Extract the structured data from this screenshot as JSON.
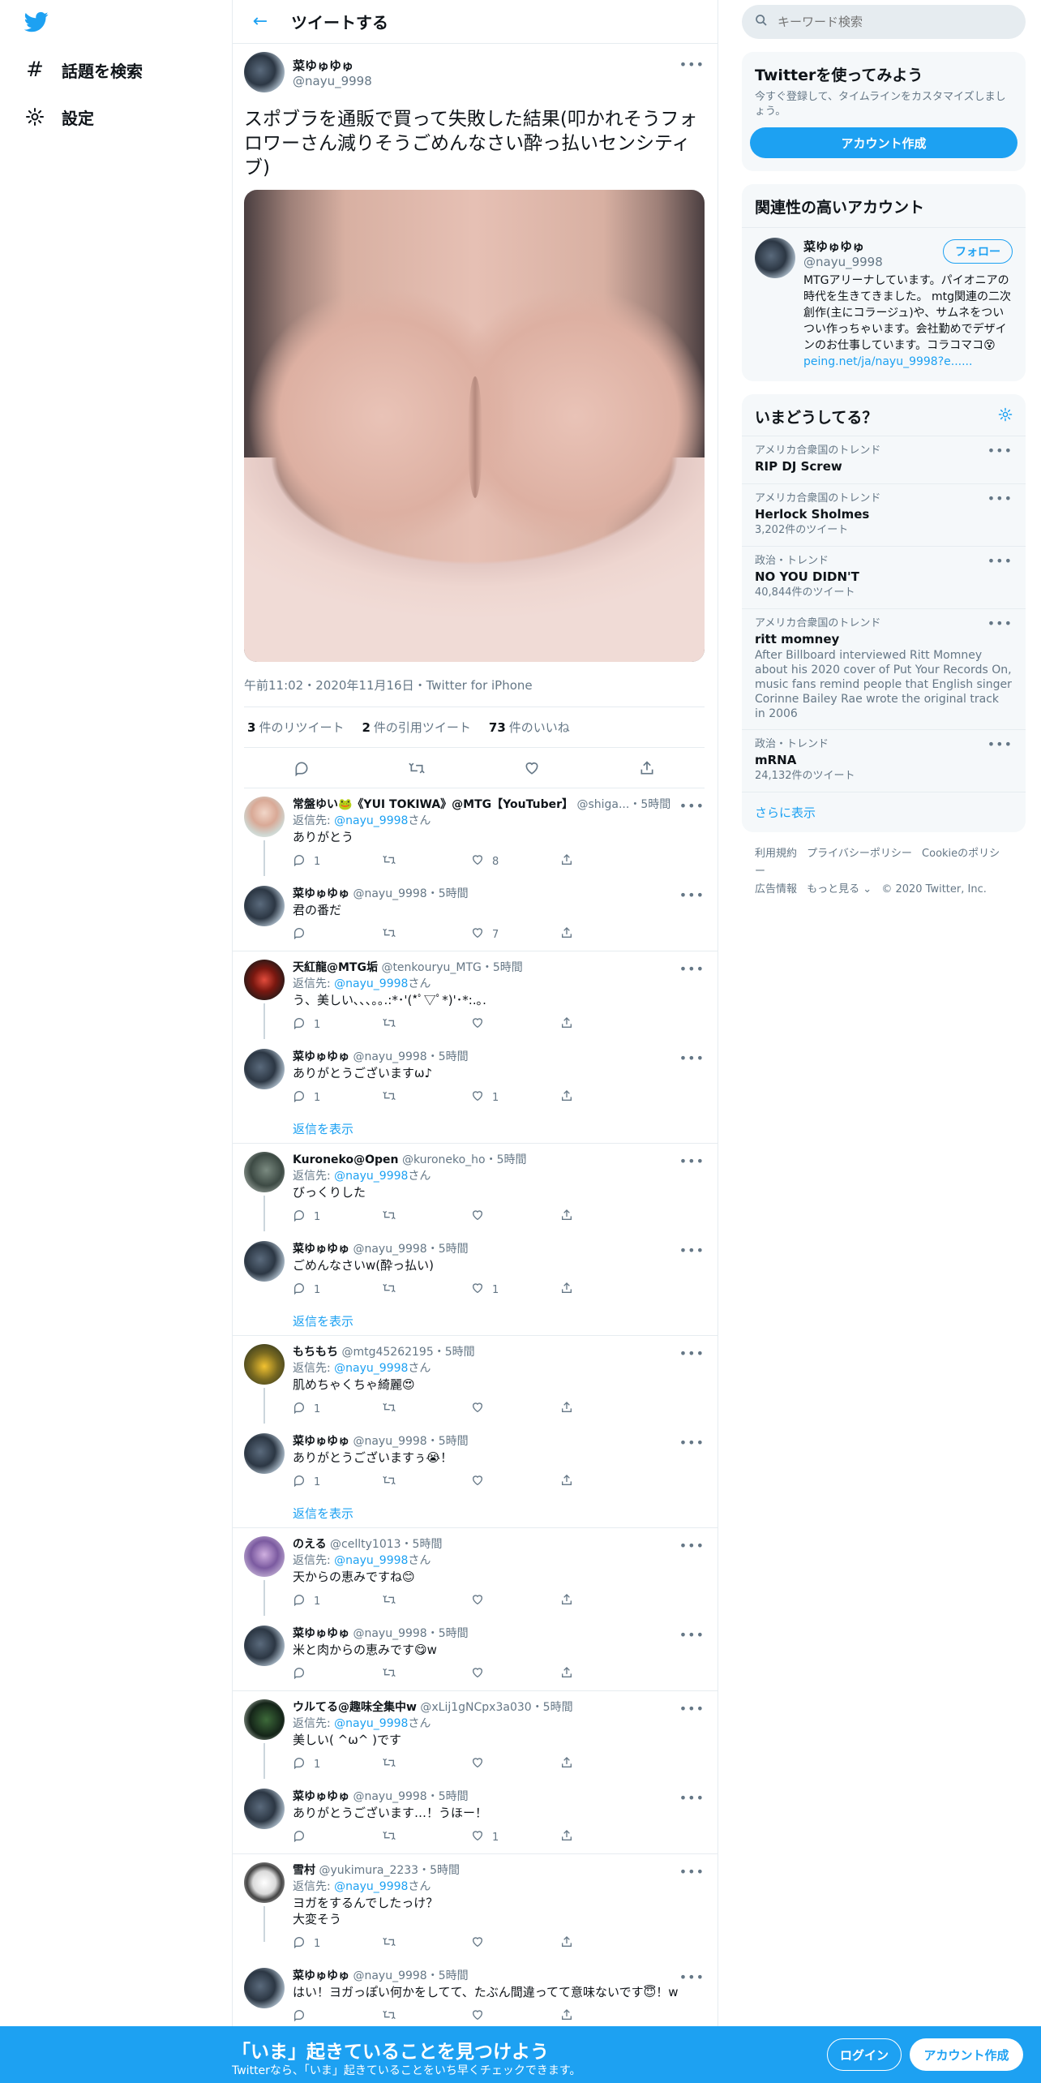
{
  "nav": {
    "explore": "話題を検索",
    "settings": "設定"
  },
  "header": {
    "title": "ツイートする"
  },
  "tweet": {
    "name": "菜ゆゅゆゅ",
    "handle": "@nayu_9998",
    "text": "スポブラを通販で買って失敗した結果(叩かれそうフォロワーさん減りそうごめんなさい酔っ払いセンシティブ)",
    "timestamp": "午前11:02・2020年11月16日・Twitter for iPhone",
    "retweets": "3",
    "retweets_label": "件のリツイート",
    "quotes": "2",
    "quotes_label": "件の引用ツイート",
    "likes": "73",
    "likes_label": "件のいいね"
  },
  "replies": [
    {
      "name": "常盤ゆい🐸《YUI TOKIWA》@MTG【YouTuber】",
      "handle": "@shiga...",
      "time": "・5時間",
      "reply_to_prefix": "返信先: ",
      "reply_to": "@nayu_9998",
      "reply_to_suffix": "さん",
      "text": "ありがとう",
      "reply_count": "1",
      "retweet_count": "",
      "like_count": "8"
    },
    {
      "name": "菜ゆゅゆゅ",
      "handle": "@nayu_9998",
      "time": "・5時間",
      "text": "君の番だ",
      "reply_count": "",
      "retweet_count": "",
      "like_count": "7"
    },
    {
      "name": "天紅龍@MTG垢",
      "handle": "@tenkouryu_MTG",
      "time": "・5時間",
      "reply_to_prefix": "返信先: ",
      "reply_to": "@nayu_9998",
      "reply_to_suffix": "さん",
      "text": "う、美しい､､､｡｡.:*･'(*ﾟ▽ﾟ*)'･*:.｡.",
      "reply_count": "1",
      "retweet_count": "",
      "like_count": ""
    },
    {
      "name": "菜ゆゅゆゅ",
      "handle": "@nayu_9998",
      "time": "・5時間",
      "text": "ありがとうございますω♪",
      "reply_count": "1",
      "retweet_count": "",
      "like_count": "1"
    },
    {
      "name": "Kuroneko@Open",
      "handle": "@kuroneko_ho",
      "time": "・5時間",
      "reply_to_prefix": "返信先: ",
      "reply_to": "@nayu_9998",
      "reply_to_suffix": "さん",
      "text": "びっくりした",
      "reply_count": "1",
      "retweet_count": "",
      "like_count": ""
    },
    {
      "name": "菜ゆゅゆゅ",
      "handle": "@nayu_9998",
      "time": "・5時間",
      "text": "ごめんなさいw(酔っ払い)",
      "reply_count": "1",
      "retweet_count": "",
      "like_count": "1"
    },
    {
      "name": "もちもち",
      "handle": "@mtg45262195",
      "time": "・5時間",
      "reply_to_prefix": "返信先: ",
      "reply_to": "@nayu_9998",
      "reply_to_suffix": "さん",
      "text": "肌めちゃくちゃ綺麗😍",
      "reply_count": "1",
      "retweet_count": "",
      "like_count": ""
    },
    {
      "name": "菜ゆゅゆゅ",
      "handle": "@nayu_9998",
      "time": "・5時間",
      "text": "ありがとうございますぅ😭！",
      "reply_count": "1",
      "retweet_count": "",
      "like_count": ""
    },
    {
      "name": "のえる",
      "handle": "@cellty1013",
      "time": "・5時間",
      "reply_to_prefix": "返信先: ",
      "reply_to": "@nayu_9998",
      "reply_to_suffix": "さん",
      "text": "天からの恵みですね😊",
      "reply_count": "1",
      "retweet_count": "",
      "like_count": ""
    },
    {
      "name": "菜ゆゅゆゅ",
      "handle": "@nayu_9998",
      "time": "・5時間",
      "text": "米と肉からの恵みです😋w",
      "reply_count": "",
      "retweet_count": "",
      "like_count": ""
    },
    {
      "name": "ウルてる@趣味全集中w",
      "handle": "@xLij1gNCpx3a030",
      "time": "・5時間",
      "reply_to_prefix": "返信先: ",
      "reply_to": "@nayu_9998",
      "reply_to_suffix": "さん",
      "text": "美しい( ^ω^ )です",
      "reply_count": "1",
      "retweet_count": "",
      "like_count": ""
    },
    {
      "name": "菜ゆゅゆゅ",
      "handle": "@nayu_9998",
      "time": "・5時間",
      "text": "ありがとうございます…！うほー！",
      "reply_count": "",
      "retweet_count": "",
      "like_count": "1"
    },
    {
      "name": "雪村",
      "handle": "@yukimura_2233",
      "time": "・5時間",
      "reply_to_prefix": "返信先: ",
      "reply_to": "@nayu_9998",
      "reply_to_suffix": "さん",
      "text": "ヨガをするんでしたっけ？",
      "text2": "大変そう",
      "reply_count": "1",
      "retweet_count": "",
      "like_count": ""
    },
    {
      "name": "菜ゆゅゆゅ",
      "handle": "@nayu_9998",
      "time": "・5時間",
      "text": "はい！ヨガっぽい何かをしてて、たぶん間違ってて意味ないです😇！w",
      "reply_count": "",
      "retweet_count": "",
      "like_count": ""
    }
  ],
  "show_replies": "返信を表示",
  "right": {
    "search_placeholder": "キーワード検索",
    "signup_card": {
      "title": "Twitterを使ってみよう",
      "subtitle": "今すぐ登録して、タイムラインをカスタマイズしましょう。",
      "button": "アカウント作成"
    },
    "relevant": {
      "title": "関連性の高いアカウント",
      "name": "菜ゆゅゆゅ",
      "handle": "@nayu_9998",
      "follow": "フォロー",
      "bio": "MTGアリーナしています。パイオニアの時代を生きてきました。 mtg関連の二次創作(主にコラージュ)や、サムネをついつい作っちゃいます。会社勤めでデザインのお仕事しています。コラコマコ😵",
      "bio_link": "peing.net/ja/nayu_9998?e......"
    },
    "trends": {
      "title": "いまどうしてる？",
      "items": [
        {
          "context": "アメリカ合衆国のトレンド",
          "name": "RIP DJ Screw",
          "count": ""
        },
        {
          "context": "アメリカ合衆国のトレンド",
          "name": "Herlock Sholmes",
          "count": "3,202件のツイート"
        },
        {
          "context": "政治・トレンド",
          "name": "NO YOU DIDN'T",
          "count": "40,844件のツイート"
        },
        {
          "context": "アメリカ合衆国のトレンド",
          "name": "ritt momney",
          "count": "",
          "desc": "After Billboard interviewed Ritt Momney about his 2020 cover of Put Your Records On, music fans remind people that English singer Corinne Bailey Rae wrote the original track in 2006"
        },
        {
          "context": "政治・トレンド",
          "name": "mRNA",
          "count": "24,132件のツイート"
        }
      ],
      "show_more": "さらに表示"
    },
    "footer": {
      "terms": "利用規約",
      "privacy": "プライバシーポリシー",
      "cookie": "Cookieのポリシー",
      "ads": "広告情報",
      "more": "もっと見る ⌄",
      "copyright": "© 2020 Twitter, Inc."
    }
  },
  "bottombar": {
    "title": "「いま」起きていることを見つけよう",
    "subtitle": "Twitterなら、「いま」起きていることをいち早くチェックできます。",
    "login": "ログイン",
    "signup": "アカウント作成"
  },
  "colors": {
    "accent": "#1da1f2",
    "muted": "#657786",
    "border": "#e6ecf0"
  }
}
